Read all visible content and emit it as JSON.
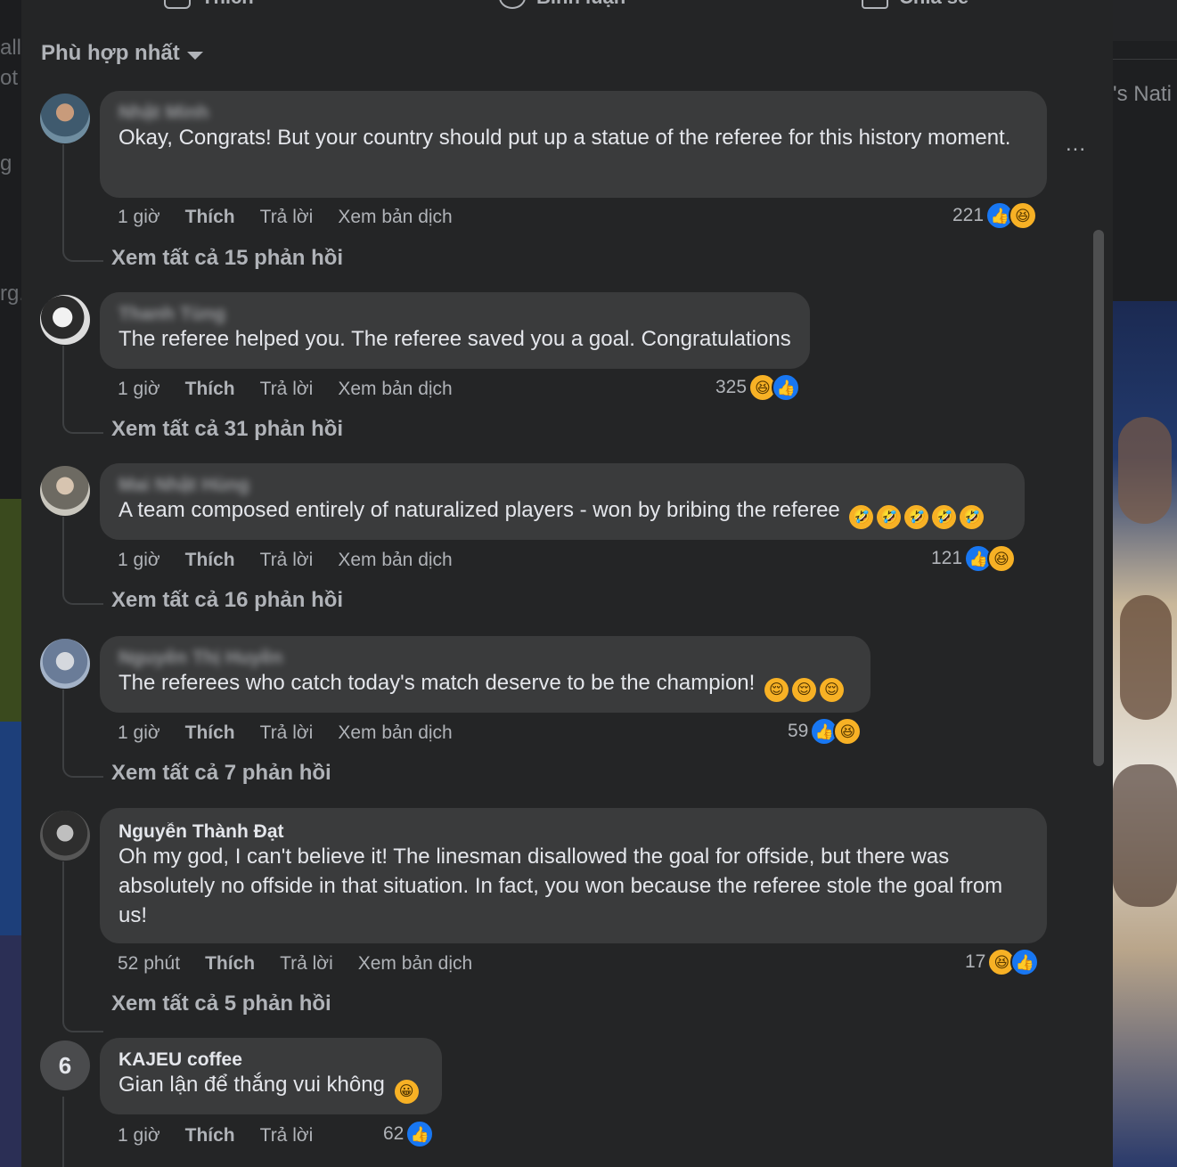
{
  "actions": {
    "like": "Thích",
    "comment": "Bình luận",
    "share": "Chia sẻ"
  },
  "sort_label": "Phù hợp nhất",
  "background_fragments": {
    "left": [
      "all",
      "ot",
      "g",
      "rg."
    ],
    "right": "'s Nati"
  },
  "more_options": "...",
  "comments": [
    {
      "author": "Nhật Minh",
      "text": "Okay, Congrats! But your country should put up a statue of the referee for this history moment.",
      "time": "1 giờ",
      "like": "Thích",
      "reply": "Trả lời",
      "translate": "Xem bản dịch",
      "reaction_count": "221",
      "reactions": [
        "like-icon",
        "haha-icon"
      ],
      "replies_label": "Xem tất cả 15 phản hồi"
    },
    {
      "author": "Thanh Tùng",
      "text": "The referee helped you. The referee saved you a goal. Congratulations",
      "time": "1 giờ",
      "like": "Thích",
      "reply": "Trả lời",
      "translate": "Xem bản dịch",
      "reaction_count": "325",
      "reactions": [
        "haha-icon",
        "like-icon"
      ],
      "replies_label": "Xem tất cả 31 phản hồi"
    },
    {
      "author": "Mai Nhật Hùng",
      "text": "A team composed entirely of naturalized players - won by bribing the referee",
      "emoji": [
        "rofl",
        "rofl",
        "rofl",
        "rofl",
        "rofl"
      ],
      "time": "1 giờ",
      "like": "Thích",
      "reply": "Trả lời",
      "translate": "Xem bản dịch",
      "reaction_count": "121",
      "reactions": [
        "like-icon",
        "haha-icon"
      ],
      "replies_label": "Xem tất cả 16 phản hồi"
    },
    {
      "author": "Nguyễn Thị Huyền",
      "text": "The referees who catch today's match deserve to be the champion!",
      "emoji": [
        "relieved",
        "relieved",
        "relieved"
      ],
      "time": "1 giờ",
      "like": "Thích",
      "reply": "Trả lời",
      "translate": "Xem bản dịch",
      "reaction_count": "59",
      "reactions": [
        "like-icon",
        "haha-icon"
      ],
      "replies_label": "Xem tất cả 7 phản hồi"
    },
    {
      "author": "Nguyễn Thành Đạt",
      "text": "Oh my god, I can't believe it! The linesman disallowed the goal for offside, but there was absolutely no offside in that situation. In fact, you won because the referee stole the goal from us!",
      "time": "52 phút",
      "like": "Thích",
      "reply": "Trả lời",
      "translate": "Xem bản dịch",
      "reaction_count": "17",
      "reactions": [
        "haha-icon",
        "like-icon"
      ],
      "replies_label": "Xem tất cả 5 phản hồi"
    },
    {
      "author": "KAJEU coffee",
      "text": "Gian lận để thắng vui không",
      "emoji": [
        "grinning"
      ],
      "time": "1 giờ",
      "like": "Thích",
      "reply": "Trả lời",
      "reaction_count": "62",
      "reactions": [
        "like-icon"
      ]
    }
  ],
  "colors": {
    "modal_bg": "#242526",
    "bubble_bg": "#3a3b3c",
    "text": "#e4e6eb",
    "muted": "#b0b3b8",
    "like_blue": "#1877f2",
    "haha_yellow": "#f7b125"
  }
}
